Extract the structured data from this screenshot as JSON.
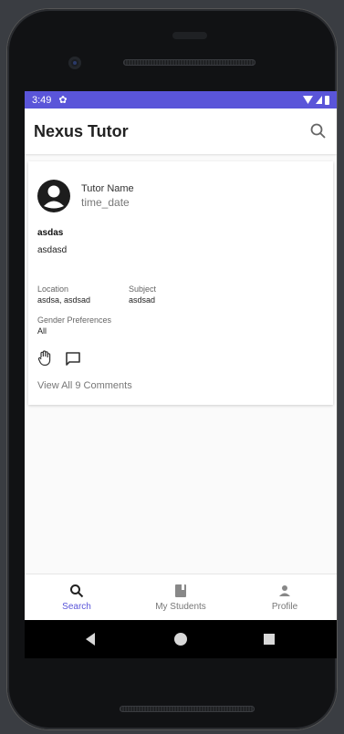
{
  "status_bar": {
    "time": "3:49"
  },
  "app_bar": {
    "title": "Nexus Tutor",
    "search_icon": "search-icon"
  },
  "post": {
    "author_name": "Tutor Name",
    "author_date": "time_date",
    "title": "asdas",
    "body": "asdasd",
    "location_label": "Location",
    "location_value": "asdsa, asdsad",
    "subject_label": "Subject",
    "subject_value": "asdsad",
    "gender_label": "Gender Preferences",
    "gender_value": "All",
    "view_comments": "View All 9 Comments"
  },
  "bottom_nav": {
    "items": [
      {
        "label": "Search",
        "icon": "search-icon"
      },
      {
        "label": "My Students",
        "icon": "book-icon"
      },
      {
        "label": "Profile",
        "icon": "person-icon"
      }
    ]
  },
  "colors": {
    "accent": "#5a55d9"
  }
}
